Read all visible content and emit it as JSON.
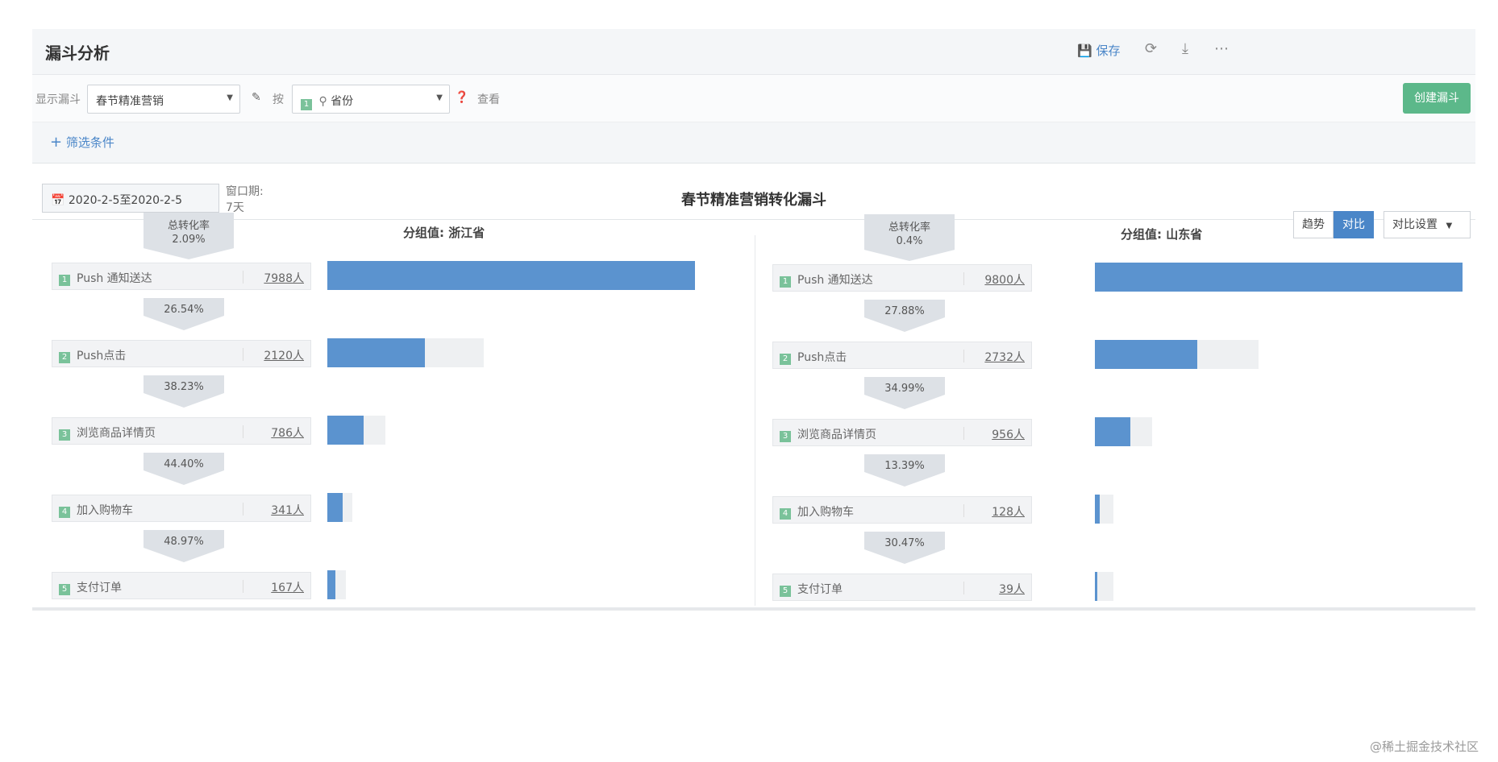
{
  "header": {
    "title": "漏斗分析",
    "save_label": "保存",
    "save_icon": "save-icon",
    "refresh_icon": "refresh-icon",
    "download_icon": "download-icon",
    "more_icon": "more-icon"
  },
  "toolbar": {
    "show_funnel_label": "显示漏斗",
    "funnel_select": "春节精准营销",
    "by_label": "按",
    "group_select": "省份",
    "group_select_num": "1",
    "view_label": "查看",
    "create_button": "创建漏斗"
  },
  "filter": {
    "add_label": "筛选条件"
  },
  "date_range": "2020-2-5至2020-2-5",
  "window_period": {
    "label": "窗口期:",
    "value": "7天"
  },
  "chart_title": "春节精准营销转化漏斗",
  "view_toggle": {
    "trend": "趋势",
    "compare": "对比",
    "compare_settings": "对比设置"
  },
  "colors": {
    "bar": "#5b93cf",
    "track": "#eef0f2",
    "primary": "#4a86c8",
    "create": "#5cb88a"
  },
  "chart_data": [
    {
      "type": "bar",
      "group_label": "分组值: 浙江省",
      "total_rate_label": "总转化率",
      "total_rate": "2.09%",
      "steps": [
        {
          "num": "1",
          "name": "Push 通知送达",
          "count": 7988,
          "count_label": "7988人"
        },
        {
          "num": "2",
          "name": "Push点击",
          "count": 2120,
          "count_label": "2120人"
        },
        {
          "num": "3",
          "name": "浏览商品详情页",
          "count": 786,
          "count_label": "786人"
        },
        {
          "num": "4",
          "name": "加入购物车",
          "count": 341,
          "count_label": "341人"
        },
        {
          "num": "5",
          "name": "支付订单",
          "count": 167,
          "count_label": "167人"
        }
      ],
      "conversions": [
        "26.54%",
        "38.23%",
        "44.40%",
        "48.97%"
      ]
    },
    {
      "type": "bar",
      "group_label": "分组值: 山东省",
      "total_rate_label": "总转化率",
      "total_rate": "0.4%",
      "steps": [
        {
          "num": "1",
          "name": "Push 通知送达",
          "count": 9800,
          "count_label": "9800人"
        },
        {
          "num": "2",
          "name": "Push点击",
          "count": 2732,
          "count_label": "2732人"
        },
        {
          "num": "3",
          "name": "浏览商品详情页",
          "count": 956,
          "count_label": "956人"
        },
        {
          "num": "4",
          "name": "加入购物车",
          "count": 128,
          "count_label": "128人"
        },
        {
          "num": "5",
          "name": "支付订单",
          "count": 39,
          "count_label": "39人"
        }
      ],
      "conversions": [
        "27.88%",
        "34.99%",
        "13.39%",
        "30.47%"
      ]
    }
  ],
  "watermark": "@稀土掘金技术社区"
}
